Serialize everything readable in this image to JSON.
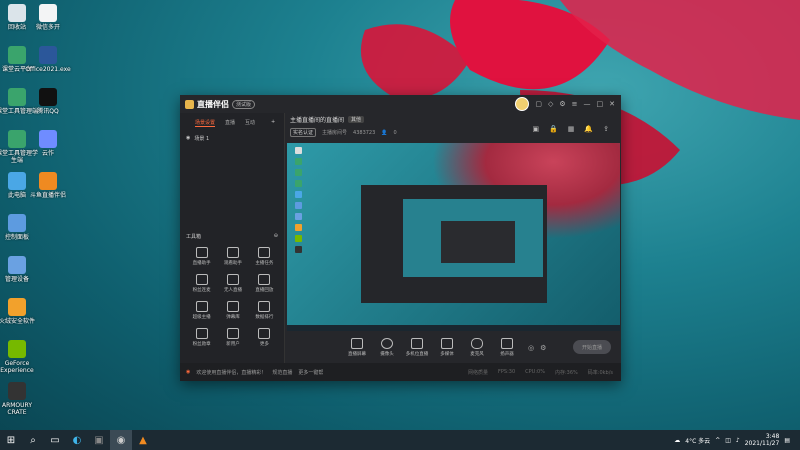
{
  "desktop": {
    "icons": [
      {
        "label": "回收站",
        "color": "#dbe4ea"
      },
      {
        "label": "微信多开",
        "color": "#f3f4f5"
      },
      {
        "label": "课堂云平台",
        "color": "#3aa46c"
      },
      {
        "label": "Office2021.exe",
        "color": "#2b579a"
      },
      {
        "label": "课堂工具管理端",
        "color": "#3aa46c"
      },
      {
        "label": "腾讯QQ",
        "color": "#111111"
      },
      {
        "label": "课堂工具管理学生端",
        "color": "#3aa46c"
      },
      {
        "label": "云作",
        "color": "#6f8cff"
      },
      {
        "label": "此电脑",
        "color": "#4aa7e6"
      },
      {
        "label": "斗鱼直播伴侣",
        "color": "#ef8a21"
      },
      {
        "label": "控制面板",
        "color": "#5d9be0"
      },
      {
        "label": "管理设备",
        "color": "#6aa1e2"
      },
      {
        "label": "火绒安全软件",
        "color": "#f2a12c"
      },
      {
        "label": "GeForce Experience",
        "color": "#76b900"
      },
      {
        "label": "ARMOURY CRATE",
        "color": "#333333"
      }
    ]
  },
  "taskbar": {
    "start_icon": "windows-icon",
    "search_icon": "search-icon",
    "apps": [
      "task-view-icon",
      "edge-icon",
      "app-icon",
      "obs-icon",
      "douyu-icon"
    ],
    "weather": "4°C 多云",
    "time": "3:48",
    "date": "2021/11/27"
  },
  "app": {
    "title": "直播伴侣",
    "version_badge": "测试版",
    "sidebar": {
      "tabs": [
        "场景设置",
        "直播",
        "互动"
      ],
      "scene_name": "场景 1",
      "tools_header": "工具箱",
      "tools": [
        "直播助手",
        "观看助手",
        "主播任务",
        "粉丝连麦",
        "无人直播",
        "直播回放",
        "超级主播",
        "弹幕库",
        "数据排行",
        "粉丝勋章",
        "新用户",
        "更多"
      ]
    },
    "main": {
      "room_title": "主播直播间的直播间",
      "room_tag": "其他",
      "verified": "实名认证",
      "room_id_label": "主播房间号",
      "room_id": "4383723",
      "viewers": "0"
    },
    "controls": [
      "直播屏幕",
      "摄像头",
      "多机位直播",
      "多媒体",
      "麦克风",
      "扬声器"
    ],
    "start_button": "开始直播",
    "status": {
      "notice": "欢迎使用直播伴侣，直播精彩！",
      "link1": "规范直播",
      "link2": "更多一键帮",
      "stats": [
        "网络质量",
        "FPS:30",
        "CPU:0%",
        "内存:36%",
        "码率:0kb/s"
      ]
    }
  }
}
